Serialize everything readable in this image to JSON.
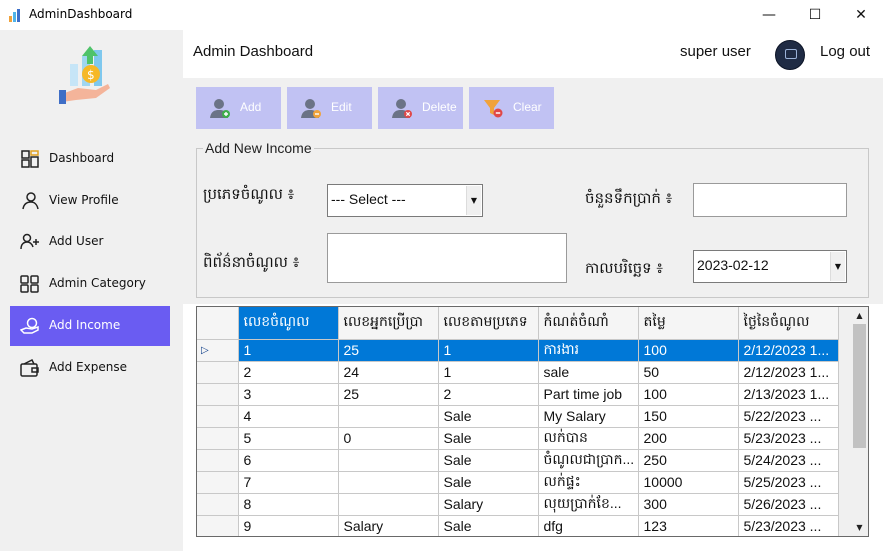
{
  "window": {
    "title": "AdminDashboard",
    "minimize": "—",
    "maximize": "☐",
    "close": "✕"
  },
  "sidebar": {
    "items": [
      {
        "label": "Dashboard",
        "icon": "dashboard-icon"
      },
      {
        "label": "View Profile",
        "icon": "user-icon"
      },
      {
        "label": "Add User",
        "icon": "user-add-icon"
      },
      {
        "label": "Admin Category",
        "icon": "grid-icon"
      },
      {
        "label": "Add Income",
        "icon": "money-hand-icon",
        "active": true
      },
      {
        "label": "Add Expense",
        "icon": "wallet-icon"
      }
    ]
  },
  "header": {
    "title": "Admin Dashboard",
    "user": "super user",
    "logout": "Log out"
  },
  "toolbar": {
    "add": "Add",
    "edit": "Edit",
    "delete": "Delete",
    "clear": "Clear"
  },
  "form": {
    "legend": "Add New Income",
    "income_type_label": "ប្រភេទចំណូល ៖",
    "income_type_value": "--- Select ---",
    "amount_label": "ចំនួនទឹកប្រាក់ ៖",
    "description_label": "ពិព័ន៌នាចំណូល ៖",
    "date_label": "កាលបរិច្ឆេទ ៖",
    "date_value": "2023-02-12"
  },
  "grid": {
    "columns": [
      "លេខចំណូល",
      "លេខអ្នកប្រើប្រា",
      "លេខតាមប្រភេទ",
      "កំណត់ចំណាំ",
      "តម្លៃ",
      "ថ្ងៃនៃចំណូល"
    ],
    "rows": [
      [
        "1",
        "25",
        "1",
        "ការងារ",
        "100",
        "2/12/2023 1..."
      ],
      [
        "2",
        "24",
        "1",
        "sale",
        "50",
        "2/12/2023 1..."
      ],
      [
        "3",
        "25",
        "2",
        "Part time job",
        "100",
        "2/13/2023 1..."
      ],
      [
        "4",
        "",
        "Sale",
        "My Salary",
        "150",
        "5/22/2023 ..."
      ],
      [
        "5",
        "0",
        "Sale",
        "លក់បាន",
        "200",
        "5/23/2023 ..."
      ],
      [
        "6",
        "",
        "Sale",
        "ចំណូលជាប្រាក...",
        "250",
        "5/24/2023 ..."
      ],
      [
        "7",
        "",
        "Sale",
        "លក់ផ្ទះ",
        "10000",
        "5/25/2023 ..."
      ],
      [
        "8",
        "",
        "Salary",
        "លុយប្រាក់ខែ...",
        "300",
        "5/26/2023 ..."
      ],
      [
        "9",
        "Salary",
        "Sale",
        "dfg",
        "123",
        "5/23/2023 ..."
      ]
    ],
    "selected_row": 0,
    "row_indicator": "▷"
  },
  "colors": {
    "accent": "#6a5cf2",
    "button": "#c1c2f3",
    "selection": "#0078d7"
  }
}
